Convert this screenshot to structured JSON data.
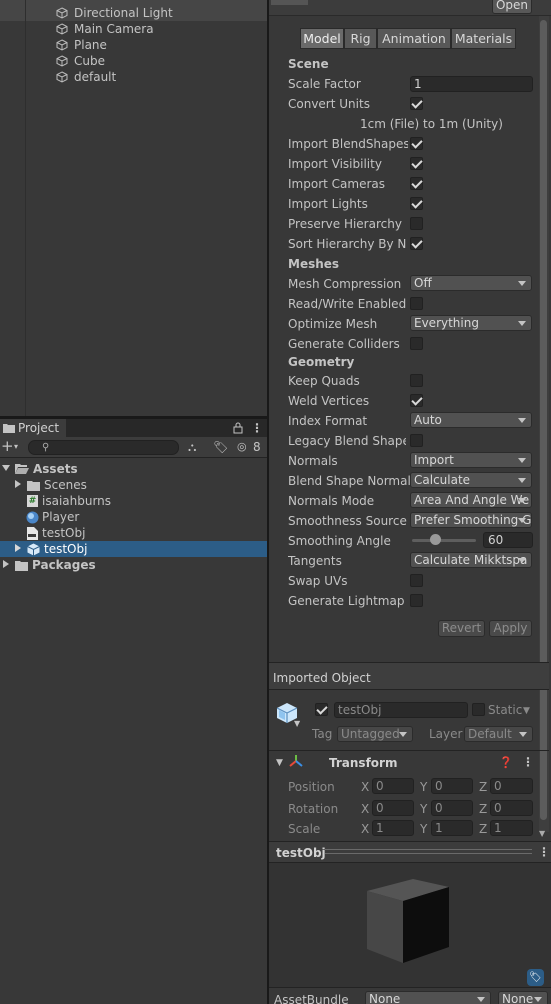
{
  "hierarchy": {
    "items": [
      {
        "label": "Directional Light"
      },
      {
        "label": "Main Camera"
      },
      {
        "label": "Plane"
      },
      {
        "label": "Cube"
      },
      {
        "label": "default"
      }
    ]
  },
  "project": {
    "tab_label": "Project",
    "hidden_count": "8",
    "search_placeholder": "",
    "tree": {
      "assets": "Assets",
      "scenes": "Scenes",
      "script": "isaiahburns",
      "player": "Player",
      "testobj1": "testObj",
      "testobj2": "testObj",
      "packages": "Packages"
    }
  },
  "inspector": {
    "open_button": "Open",
    "tabs": [
      "Model",
      "Rig",
      "Animation",
      "Materials"
    ],
    "scene_header": "Scene",
    "scale_factor_label": "Scale Factor",
    "scale_factor_value": "1",
    "convert_units_label": "Convert Units",
    "convert_units_note": "1cm (File) to 1m (Unity)",
    "import_blendshapes": "Import BlendShapes",
    "import_visibility": "Import Visibility",
    "import_cameras": "Import Cameras",
    "import_lights": "Import Lights",
    "preserve_hierarchy": "Preserve Hierarchy",
    "sort_hierarchy": "Sort Hierarchy By Na",
    "meshes_header": "Meshes",
    "mesh_compression_label": "Mesh Compression",
    "mesh_compression_value": "Off",
    "read_write_label": "Read/Write Enabled",
    "optimize_mesh_label": "Optimize Mesh",
    "optimize_mesh_value": "Everything",
    "generate_colliders_label": "Generate Colliders",
    "geometry_header": "Geometry",
    "keep_quads_label": "Keep Quads",
    "weld_vertices_label": "Weld Vertices",
    "index_format_label": "Index Format",
    "index_format_value": "Auto",
    "legacy_blend_label": "Legacy Blend Shape",
    "normals_label": "Normals",
    "normals_value": "Import",
    "blend_shape_normals_label": "Blend Shape Normals",
    "blend_shape_normals_value": "Calculate",
    "normals_mode_label": "Normals Mode",
    "normals_mode_value": "Area And Angle We",
    "smoothness_source_label": "Smoothness Source",
    "smoothness_source_value": "Prefer Smoothing G",
    "smoothing_angle_label": "Smoothing Angle",
    "smoothing_angle_value": "60",
    "smoothing_angle_fraction": 0.333,
    "tangents_label": "Tangents",
    "tangents_value": "Calculate Mikktspa",
    "swap_uvs_label": "Swap UVs",
    "generate_lightmap_label": "Generate Lightmap U",
    "revert_button": "Revert",
    "apply_button": "Apply",
    "imported_object_header": "Imported Object",
    "object_name": "testObj",
    "static_label": "Static",
    "tag_label": "Tag",
    "tag_value": "Untagged",
    "layer_label": "Layer",
    "layer_value": "Default",
    "transform_header": "Transform",
    "position_label": "Position",
    "rotation_label": "Rotation",
    "scale_label": "Scale",
    "axis_x": "X",
    "axis_y": "Y",
    "axis_z": "Z",
    "position": [
      "0",
      "0",
      "0"
    ],
    "rotation": [
      "0",
      "0",
      "0"
    ],
    "scale": [
      "1",
      "1",
      "1"
    ]
  },
  "preview": {
    "title": "testObj",
    "assetbundle_label": "AssetBundle",
    "assetbundle_value": "None",
    "assetbundle_variant": "None"
  },
  "colors": {
    "selection": "#2c5d87",
    "panel": "#383838",
    "field": "#2a2a2a"
  }
}
